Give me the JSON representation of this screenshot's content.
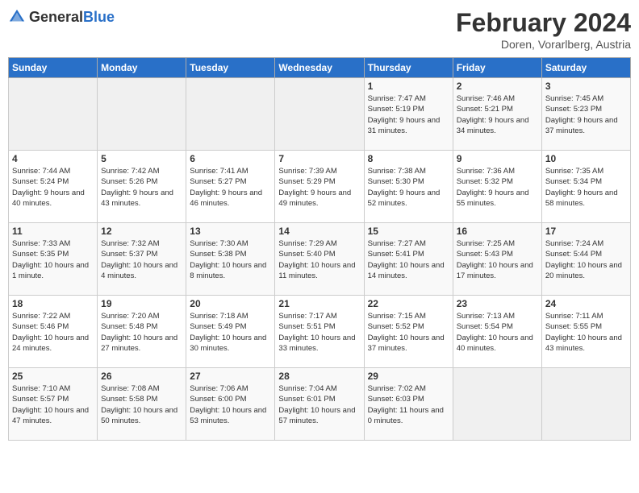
{
  "header": {
    "logo_general": "General",
    "logo_blue": "Blue",
    "month": "February 2024",
    "location": "Doren, Vorarlberg, Austria"
  },
  "weekdays": [
    "Sunday",
    "Monday",
    "Tuesday",
    "Wednesday",
    "Thursday",
    "Friday",
    "Saturday"
  ],
  "weeks": [
    [
      {
        "day": "",
        "info": ""
      },
      {
        "day": "",
        "info": ""
      },
      {
        "day": "",
        "info": ""
      },
      {
        "day": "",
        "info": ""
      },
      {
        "day": "1",
        "info": "Sunrise: 7:47 AM\nSunset: 5:19 PM\nDaylight: 9 hours and 31 minutes."
      },
      {
        "day": "2",
        "info": "Sunrise: 7:46 AM\nSunset: 5:21 PM\nDaylight: 9 hours and 34 minutes."
      },
      {
        "day": "3",
        "info": "Sunrise: 7:45 AM\nSunset: 5:23 PM\nDaylight: 9 hours and 37 minutes."
      }
    ],
    [
      {
        "day": "4",
        "info": "Sunrise: 7:44 AM\nSunset: 5:24 PM\nDaylight: 9 hours and 40 minutes."
      },
      {
        "day": "5",
        "info": "Sunrise: 7:42 AM\nSunset: 5:26 PM\nDaylight: 9 hours and 43 minutes."
      },
      {
        "day": "6",
        "info": "Sunrise: 7:41 AM\nSunset: 5:27 PM\nDaylight: 9 hours and 46 minutes."
      },
      {
        "day": "7",
        "info": "Sunrise: 7:39 AM\nSunset: 5:29 PM\nDaylight: 9 hours and 49 minutes."
      },
      {
        "day": "8",
        "info": "Sunrise: 7:38 AM\nSunset: 5:30 PM\nDaylight: 9 hours and 52 minutes."
      },
      {
        "day": "9",
        "info": "Sunrise: 7:36 AM\nSunset: 5:32 PM\nDaylight: 9 hours and 55 minutes."
      },
      {
        "day": "10",
        "info": "Sunrise: 7:35 AM\nSunset: 5:34 PM\nDaylight: 9 hours and 58 minutes."
      }
    ],
    [
      {
        "day": "11",
        "info": "Sunrise: 7:33 AM\nSunset: 5:35 PM\nDaylight: 10 hours and 1 minute."
      },
      {
        "day": "12",
        "info": "Sunrise: 7:32 AM\nSunset: 5:37 PM\nDaylight: 10 hours and 4 minutes."
      },
      {
        "day": "13",
        "info": "Sunrise: 7:30 AM\nSunset: 5:38 PM\nDaylight: 10 hours and 8 minutes."
      },
      {
        "day": "14",
        "info": "Sunrise: 7:29 AM\nSunset: 5:40 PM\nDaylight: 10 hours and 11 minutes."
      },
      {
        "day": "15",
        "info": "Sunrise: 7:27 AM\nSunset: 5:41 PM\nDaylight: 10 hours and 14 minutes."
      },
      {
        "day": "16",
        "info": "Sunrise: 7:25 AM\nSunset: 5:43 PM\nDaylight: 10 hours and 17 minutes."
      },
      {
        "day": "17",
        "info": "Sunrise: 7:24 AM\nSunset: 5:44 PM\nDaylight: 10 hours and 20 minutes."
      }
    ],
    [
      {
        "day": "18",
        "info": "Sunrise: 7:22 AM\nSunset: 5:46 PM\nDaylight: 10 hours and 24 minutes."
      },
      {
        "day": "19",
        "info": "Sunrise: 7:20 AM\nSunset: 5:48 PM\nDaylight: 10 hours and 27 minutes."
      },
      {
        "day": "20",
        "info": "Sunrise: 7:18 AM\nSunset: 5:49 PM\nDaylight: 10 hours and 30 minutes."
      },
      {
        "day": "21",
        "info": "Sunrise: 7:17 AM\nSunset: 5:51 PM\nDaylight: 10 hours and 33 minutes."
      },
      {
        "day": "22",
        "info": "Sunrise: 7:15 AM\nSunset: 5:52 PM\nDaylight: 10 hours and 37 minutes."
      },
      {
        "day": "23",
        "info": "Sunrise: 7:13 AM\nSunset: 5:54 PM\nDaylight: 10 hours and 40 minutes."
      },
      {
        "day": "24",
        "info": "Sunrise: 7:11 AM\nSunset: 5:55 PM\nDaylight: 10 hours and 43 minutes."
      }
    ],
    [
      {
        "day": "25",
        "info": "Sunrise: 7:10 AM\nSunset: 5:57 PM\nDaylight: 10 hours and 47 minutes."
      },
      {
        "day": "26",
        "info": "Sunrise: 7:08 AM\nSunset: 5:58 PM\nDaylight: 10 hours and 50 minutes."
      },
      {
        "day": "27",
        "info": "Sunrise: 7:06 AM\nSunset: 6:00 PM\nDaylight: 10 hours and 53 minutes."
      },
      {
        "day": "28",
        "info": "Sunrise: 7:04 AM\nSunset: 6:01 PM\nDaylight: 10 hours and 57 minutes."
      },
      {
        "day": "29",
        "info": "Sunrise: 7:02 AM\nSunset: 6:03 PM\nDaylight: 11 hours and 0 minutes."
      },
      {
        "day": "",
        "info": ""
      },
      {
        "day": "",
        "info": ""
      }
    ]
  ]
}
